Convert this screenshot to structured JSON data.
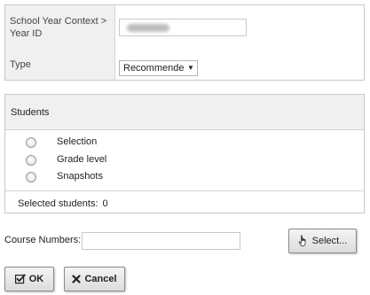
{
  "form": {
    "year_label": "School Year Context > Year ID",
    "type_label": "Type",
    "type_value": "Recommended"
  },
  "students": {
    "header": "Students",
    "options": [
      "Selection",
      "Grade level",
      "Snapshots"
    ],
    "selected_label": "Selected students:",
    "selected_count": "0"
  },
  "course": {
    "label": "Course Numbers:",
    "value": ""
  },
  "buttons": {
    "select": "Select...",
    "ok": "OK",
    "cancel": "Cancel"
  }
}
